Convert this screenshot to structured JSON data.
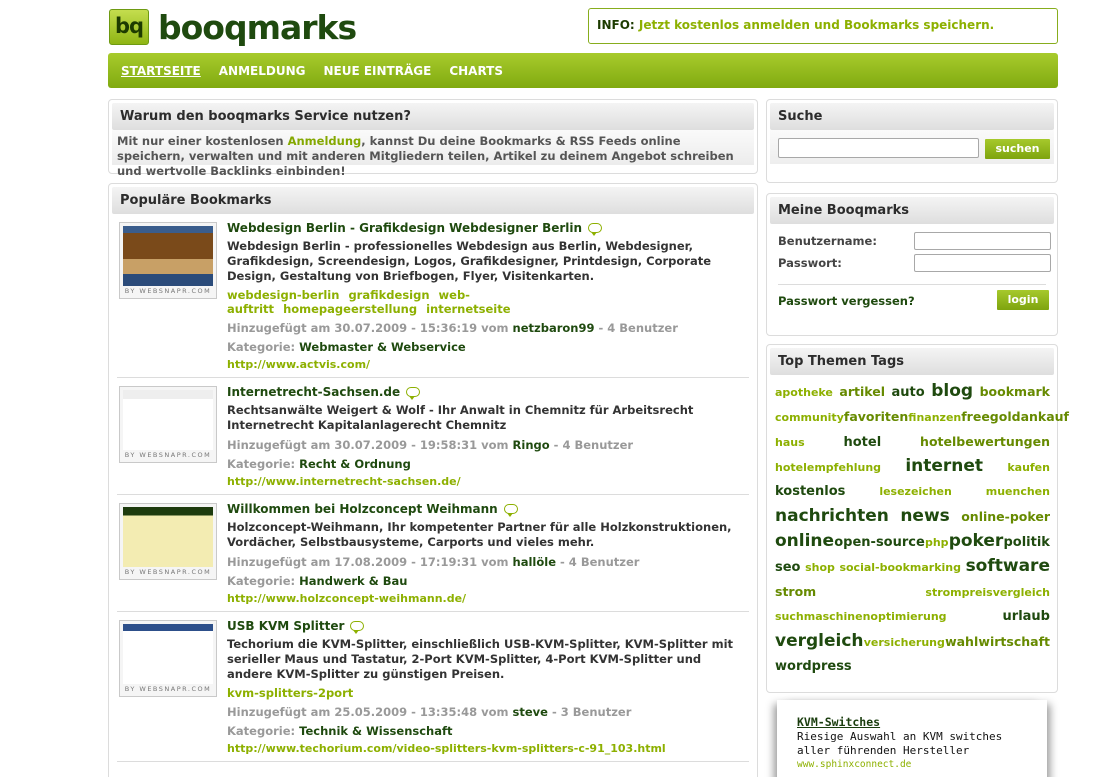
{
  "header": {
    "logo_mark": "bq",
    "logo_text": "booqmarks",
    "info_label": "INFO:",
    "info_text": "Jetzt kostenlos anmelden und Bookmarks speichern."
  },
  "nav": {
    "items": [
      {
        "label": "STARTSEITE"
      },
      {
        "label": "ANMELDUNG"
      },
      {
        "label": "NEUE EINTRÄGE"
      },
      {
        "label": "CHARTS"
      }
    ]
  },
  "intro": {
    "title": "Warum den booqmarks Service nutzen?",
    "text_before": "Mit nur einer kostenlosen ",
    "link": "Anmeldung",
    "text_after": ", kannst Du deine Bookmarks & RSS Feeds online speichern, verwalten und mit anderen Mitgliedern teilen, Artikel zu deinem Angebot schreiben und wertvolle Backlinks einbinden!"
  },
  "popular": {
    "title": "Populäre Bookmarks",
    "thumb_label": "BY WEBSNAPR.COM",
    "added_prefix": "Hinzugefügt am",
    "by_word": "vom",
    "category_label": "Kategorie:",
    "items": [
      {
        "title": "Webdesign Berlin - Grafikdesign Webdesigner Berlin",
        "desc": "Webdesign Berlin - professionelles Webdesign aus Berlin, Webdesigner, Grafikdesign, Screendesign, Logos, Grafikdesigner, Printdesign, Corporate Design, Gestaltung von Briefbogen, Flyer, Visitenkarten.",
        "tags": [
          "webdesign-berlin",
          "grafikdesign",
          "web-auftritt",
          "homepageerstellung",
          "internetseite"
        ],
        "date": "30.07.2009 - 15:36:19",
        "user": "netzbaron99",
        "users": "- 4 Benutzer",
        "category": "Webmaster & Webservice",
        "url": "http://www.actvis.com/"
      },
      {
        "title": "Internetrecht-Sachsen.de",
        "desc": "Rechtsanwälte Weigert & Wolf - Ihr Anwalt in Chemnitz für Arbeitsrecht Internetrecht Kapitalanlagerecht Chemnitz",
        "tags": [],
        "date": "30.07.2009 - 19:58:31",
        "user": "Ringo",
        "users": "- 4 Benutzer",
        "category": "Recht & Ordnung",
        "url": "http://www.internetrecht-sachsen.de/"
      },
      {
        "title": "Willkommen bei Holzconcept Weihmann",
        "desc": "Holzconcept-Weihmann, Ihr kompetenter Partner für alle Holzkonstruktionen, Vordächer, Selbstbausysteme, Carports und vieles mehr.",
        "tags": [],
        "date": "17.08.2009 - 17:19:31",
        "user": "hallöle",
        "users": "- 4 Benutzer",
        "category": "Handwerk & Bau",
        "url": "http://www.holzconcept-weihmann.de/"
      },
      {
        "title": "USB KVM Splitter",
        "desc": "Techorium die KVM-Splitter, einschließlich USB-KVM-Splitter, KVM-Splitter mit serieller Maus und Tastatur, 2-Port KVM-Splitter, 4-Port KVM-Splitter und andere KVM-Splitter zu günstigen Preisen.",
        "tags": [
          "kvm-splitters-2port"
        ],
        "date": "25.05.2009 - 13:35:48",
        "user": "steve",
        "users": "- 3 Benutzer",
        "category": "Technik & Wissenschaft",
        "url": "http://www.techorium.com/video-splitters-kvm-splitters-c-91_103.html"
      }
    ]
  },
  "search": {
    "title": "Suche",
    "button": "suchen",
    "value": ""
  },
  "login": {
    "title": "Meine Booqmarks",
    "username_label": "Benutzername:",
    "password_label": "Passwort:",
    "forgot": "Passwort vergessen?",
    "button": "login"
  },
  "tags": {
    "title": "Top Themen Tags",
    "lines": [
      [
        [
          "apotheke",
          1
        ],
        [
          "artikel",
          2
        ],
        [
          "auto",
          3
        ],
        [
          "blog",
          5
        ],
        [
          "bookmark",
          2
        ]
      ],
      [
        [
          "community",
          1
        ],
        [
          "favoriten",
          2
        ],
        [
          "finanzen",
          1
        ],
        [
          "free",
          2
        ],
        [
          "goldankauf",
          2
        ]
      ],
      [
        [
          "haus",
          1
        ],
        [
          "hotel",
          3
        ],
        [
          "hotelbewertungen",
          2
        ]
      ],
      [
        [
          "hotelempfehlung",
          1
        ],
        [
          "internet",
          5
        ],
        [
          "kaufen",
          1
        ]
      ],
      [
        [
          "kostenlos",
          3
        ],
        [
          "lesezeichen",
          1
        ],
        [
          "muenchen",
          1
        ]
      ],
      [
        [
          "nachrichten",
          5
        ],
        [
          "news",
          5
        ],
        [
          "online-poker",
          2
        ]
      ],
      [
        [
          "online",
          5
        ],
        [
          "open-source",
          3
        ],
        [
          "php",
          1
        ],
        [
          "poker",
          5
        ],
        [
          "politik",
          3
        ]
      ],
      [
        [
          "seo",
          3
        ],
        [
          "shop",
          1
        ],
        [
          "social-bookmarking",
          1
        ],
        [
          "software",
          5
        ]
      ],
      [
        [
          "strom",
          2
        ],
        [
          "strompreisvergleich",
          1
        ]
      ],
      [
        [
          "suchmaschinenoptimierung",
          1
        ],
        [
          "urlaub",
          3
        ]
      ],
      [
        [
          "vergleich",
          5
        ],
        [
          "versicherung",
          1
        ],
        [
          "wahl",
          2
        ],
        [
          "wirtschaft",
          2
        ]
      ],
      [
        [
          "wordpress",
          3
        ]
      ]
    ]
  },
  "ad": {
    "title": "KVM-Switches",
    "text": "Riesige Auswahl an KVM switches aller führenden Hersteller",
    "url": "www.sphinxconnect.de"
  }
}
